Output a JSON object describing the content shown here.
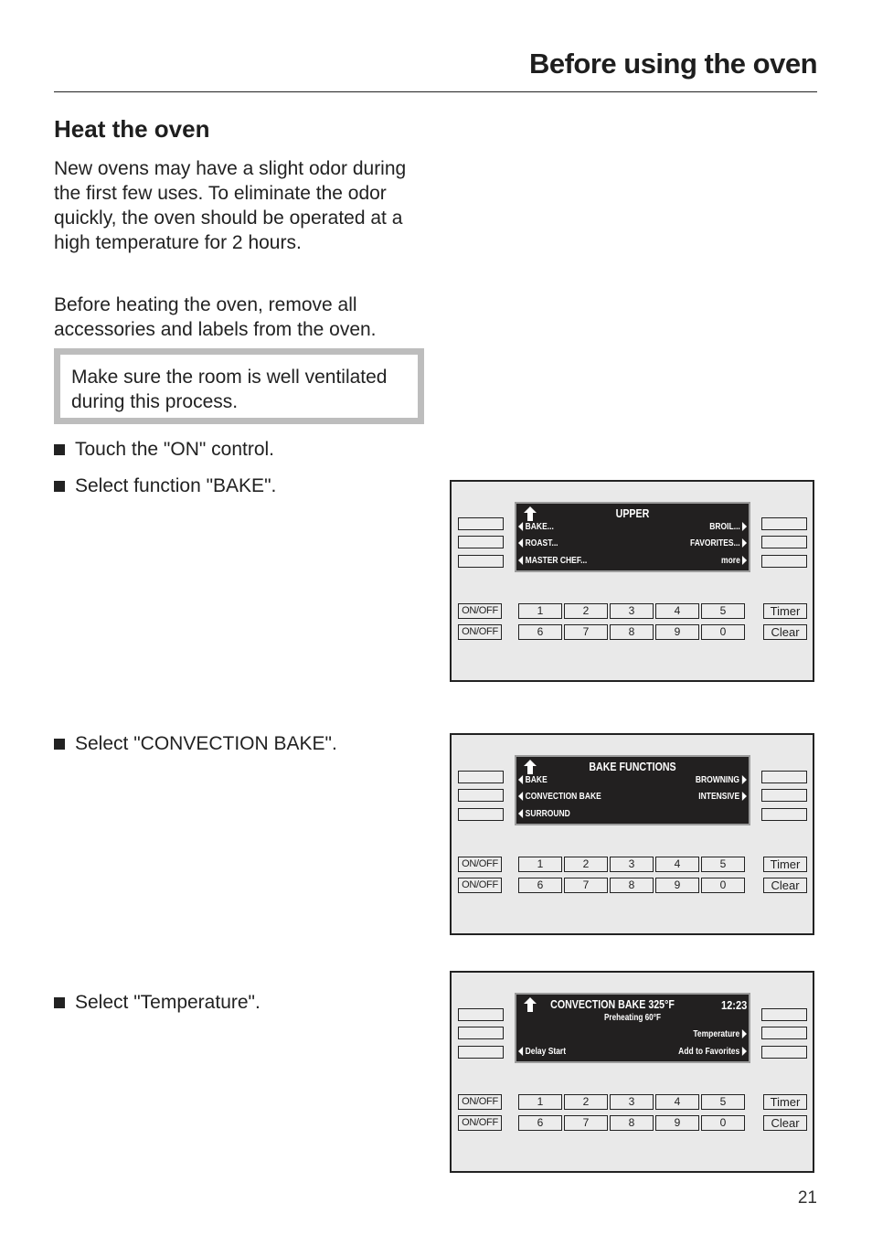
{
  "header": {
    "title": "Before using the oven"
  },
  "section": {
    "title": "Heat the oven",
    "paragraphs": [
      "New ovens may have a slight odor during the first few uses. To eliminate the odor quickly, the oven should be operated at a high temperature for 2 hours.",
      "Before heating the oven, remove all accessories and labels from the oven."
    ],
    "note": "Make sure the room is well ventilated during this process."
  },
  "steps": [
    "Touch the \"ON\" control.",
    "Select function \"BAKE\".",
    "Select \"CONVECTION BAKE\".",
    "Select \"Temperature\"."
  ],
  "keypad": {
    "onoff": [
      "ON/OFF",
      "ON/OFF"
    ],
    "row1": [
      "1",
      "2",
      "3",
      "4",
      "5"
    ],
    "row2": [
      "6",
      "7",
      "8",
      "9",
      "0"
    ],
    "timer": "Timer",
    "clear": "Clear"
  },
  "panels": [
    {
      "title": "UPPER",
      "left": [
        "BAKE...",
        "ROAST...",
        "MASTER CHEF..."
      ],
      "right": [
        "BROIL...",
        "FAVORITES...",
        "more"
      ]
    },
    {
      "title": "BAKE FUNCTIONS",
      "left": [
        "BAKE",
        "CONVECTION BAKE",
        "SURROUND"
      ],
      "right": [
        "BROWNING",
        "INTENSIVE",
        ""
      ]
    },
    {
      "title": "CONVECTION BAKE 325°F",
      "time": "12:23",
      "subtitle": "Preheating 60°F",
      "left": [
        "",
        "",
        "Delay Start"
      ],
      "right": [
        "",
        "Temperature",
        "Add to Favorites"
      ]
    }
  ],
  "colors": {
    "display_bg": "#222020",
    "panel_bg": "#e9e9e9",
    "note_border": "#bdbdbd"
  },
  "page_number": "21"
}
